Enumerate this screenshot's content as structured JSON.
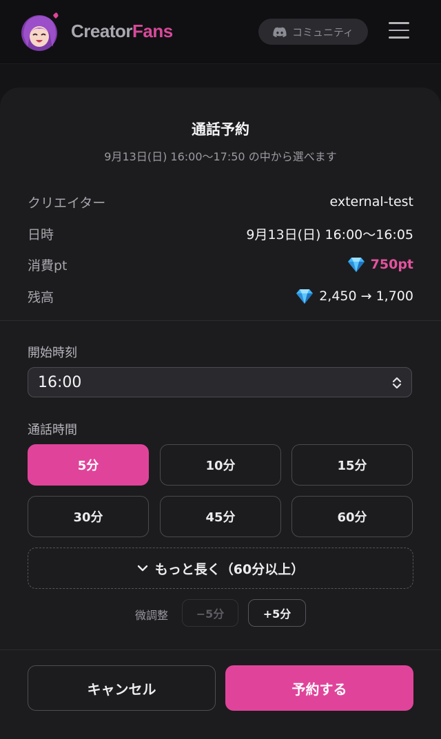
{
  "header": {
    "brand_part1": "Creator",
    "brand_part2": "Fans",
    "community_label": "コミュニティ",
    "brand_color": "#d9499a"
  },
  "sheet": {
    "title": "通話予約",
    "subtitle": "9月13日(日) 16:00〜17:50 の中から選べます",
    "info": {
      "creator_label": "クリエイター",
      "creator_value": "external-test",
      "datetime_label": "日時",
      "datetime_value": "9月13日(日) 16:00〜16:05",
      "cost_label": "消費pt",
      "cost_value": "750pt",
      "balance_label": "残高",
      "balance_value": "2,450 → 1,700"
    },
    "start_time": {
      "label": "開始時刻",
      "value": "16:00"
    },
    "duration": {
      "label": "通話時間",
      "options": [
        "5分",
        "10分",
        "15分",
        "30分",
        "45分",
        "60分"
      ],
      "selected": "5分",
      "more_label": "もっと長く（60分以上）"
    },
    "fine_adjust": {
      "label": "微調整",
      "minus_label": "−5分",
      "plus_label": "+5分"
    },
    "footer": {
      "cancel_label": "キャンセル",
      "confirm_label": "予約する"
    },
    "accent_color": "#e0449a",
    "icons": [
      "discord-icon",
      "hamburger-menu-icon",
      "diamond-gem-icon",
      "chevron-updown-icon",
      "chevron-down-icon"
    ]
  }
}
